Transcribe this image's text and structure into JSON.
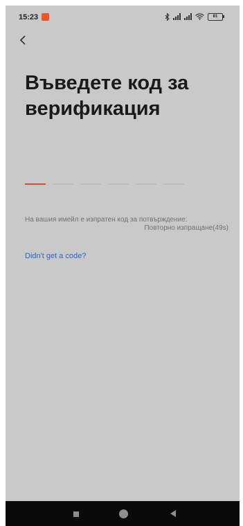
{
  "status_bar": {
    "time": "15:23",
    "battery": "81"
  },
  "header": {
    "title": "Въведете код за верификация"
  },
  "code_input": {
    "length": 6,
    "filled": 0
  },
  "info": {
    "sent_message": "На вашия имейл е изпратен код за потвърждение:",
    "resend_label": "Повторно изпращане(49s)"
  },
  "help": {
    "link_label": "Didn't get a code?"
  },
  "colors": {
    "accent": "#e24a1f",
    "link": "#2a64c4",
    "background": "#c9c9c9"
  },
  "icons": {
    "back": "chevron-left-icon",
    "bluetooth": "bluetooth-icon",
    "wifi": "wifi-icon",
    "battery": "battery-icon"
  }
}
